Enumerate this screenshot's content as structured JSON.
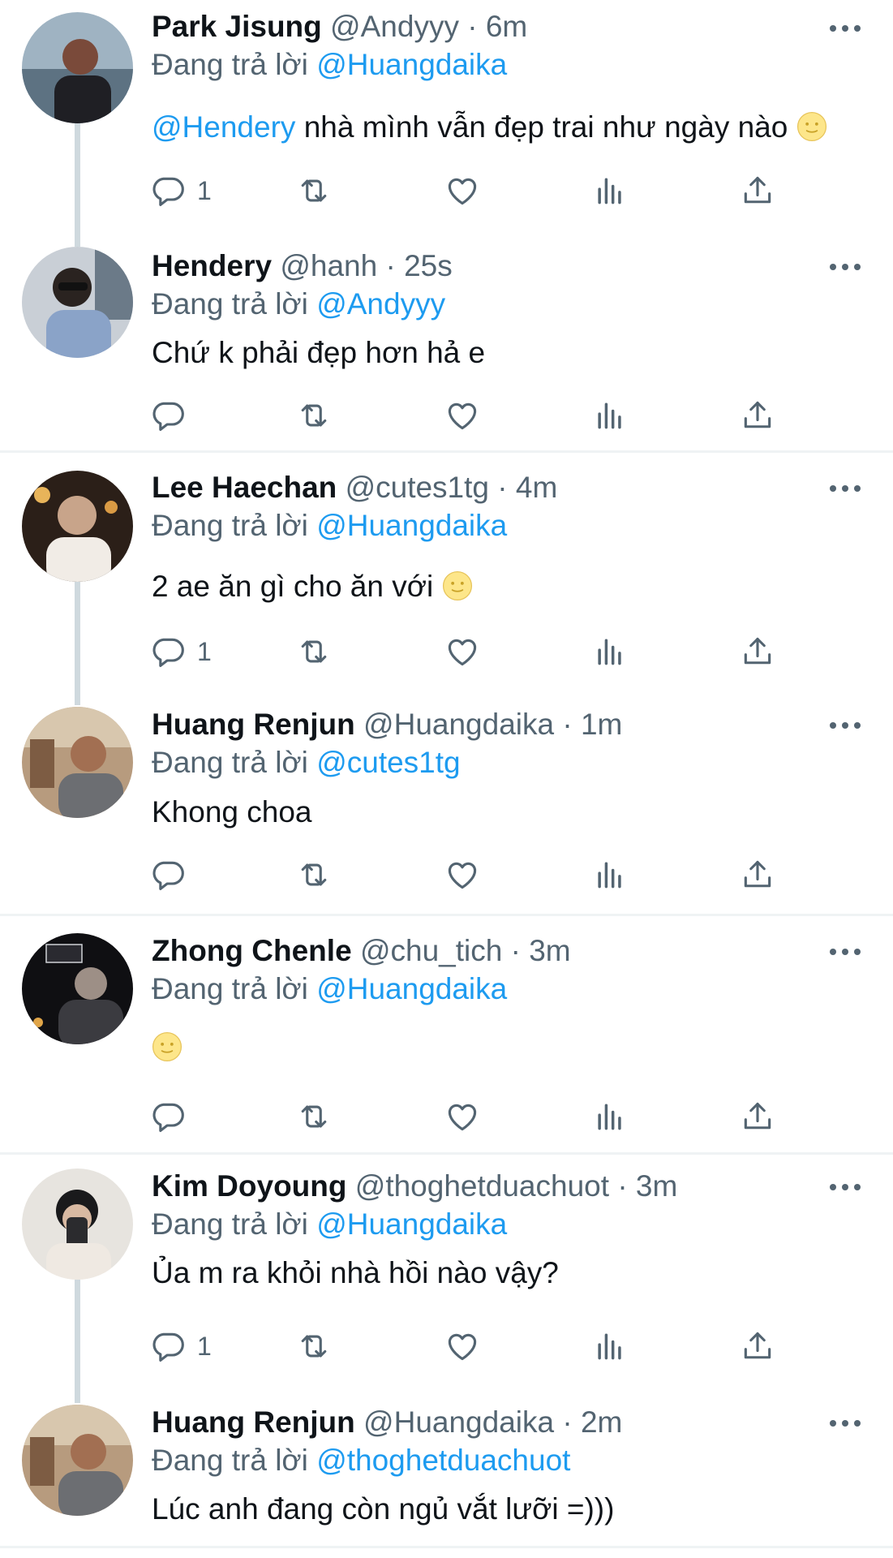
{
  "reply_prefix": "Đang trả lời",
  "tweets": [
    {
      "name": "Park Jisung",
      "handle": "@Andyyy",
      "sep": "·",
      "time": "6m",
      "reply_to": "@Huangdaika",
      "body_mention": "@Hendery",
      "body": "nhà mình vẫn đẹp trai như ngày nào",
      "body_emoji": "slightly-smiling-face-icon",
      "reply_count": "1"
    },
    {
      "name": "Hendery",
      "handle": "@hanh",
      "sep": "·",
      "time": "25s",
      "reply_to": "@Andyyy",
      "body": "Chứ k phải đẹp hơn hả e",
      "reply_count": ""
    },
    {
      "name": "Lee Haechan",
      "handle": "@cutes1tg",
      "sep": "·",
      "time": "4m",
      "reply_to": "@Huangdaika",
      "body": "2 ae ăn gì cho ăn với",
      "body_emoji": "slightly-smiling-face-icon",
      "reply_count": "1"
    },
    {
      "name": "Huang Renjun",
      "handle": "@Huangdaika",
      "sep": "·",
      "time": "1m",
      "reply_to": "@cutes1tg",
      "body": "Khong choa",
      "reply_count": ""
    },
    {
      "name": "Zhong Chenle",
      "handle": "@chu_tich",
      "sep": "·",
      "time": "3m",
      "reply_to": "@Huangdaika",
      "body": "",
      "body_emoji": "slightly-smiling-face-icon",
      "reply_count": ""
    },
    {
      "name": "Kim Doyoung",
      "handle": "@thoghetduachuot",
      "sep": "·",
      "time": "3m",
      "reply_to": "@Huangdaika",
      "body": "Ủa m ra khỏi nhà hồi nào vậy?",
      "reply_count": "1"
    },
    {
      "name": "Huang Renjun",
      "handle": "@Huangdaika",
      "sep": "·",
      "time": "2m",
      "reply_to": "@thoghetduachuot",
      "body": "Lúc anh đang còn ngủ vắt lưỡi =)))"
    }
  ],
  "colors": {
    "link": "#1d9bf0",
    "secondary": "#536471",
    "text": "#0f1419",
    "divider": "#eff3f4",
    "thread": "#cfd9de"
  }
}
